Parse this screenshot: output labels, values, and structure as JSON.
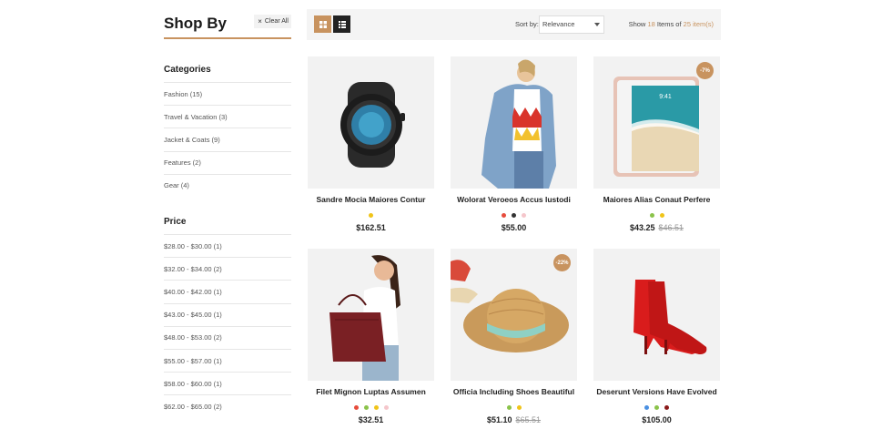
{
  "sidebar": {
    "title": "Shop By",
    "clear_all": "Clear All",
    "categories_title": "Categories",
    "categories": [
      {
        "label": "Fashion (15)"
      },
      {
        "label": "Travel & Vacation (3)"
      },
      {
        "label": "Jacket & Coats (9)"
      },
      {
        "label": "Features (2)"
      },
      {
        "label": "Gear (4)"
      }
    ],
    "price_title": "Price",
    "prices": [
      {
        "label": "$28.00 - $30.00 (1)"
      },
      {
        "label": "$32.00 - $34.00 (2)"
      },
      {
        "label": "$40.00 - $42.00 (1)"
      },
      {
        "label": "$43.00 - $45.00 (1)"
      },
      {
        "label": "$48.00 - $53.00 (2)"
      },
      {
        "label": "$55.00 - $57.00 (1)"
      },
      {
        "label": "$58.00 - $60.00 (1)"
      },
      {
        "label": "$62.00 - $65.00 (2)"
      }
    ]
  },
  "toolbar": {
    "grid_icon": "grid-view-icon",
    "list_icon": "list-view-icon",
    "sort_label": "Sort by:",
    "sort_value": "Relevance",
    "show_prefix": "Show",
    "show_count": "18",
    "show_middle": "Items of",
    "show_total": "25 item(s)"
  },
  "accent_color": "#c8935f",
  "products": [
    {
      "name": "Sandre Mocia Maiores Contur",
      "price": "$162.51",
      "old_price": "",
      "badge": "",
      "colors": [
        "#f0c419"
      ],
      "image": "smartwatch"
    },
    {
      "name": "Wolorat Veroeos Accus Iustodi",
      "price": "$55.00",
      "old_price": "",
      "badge": "",
      "colors": [
        "#e74c3c",
        "#333333",
        "#f5c6cb"
      ],
      "image": "denim-jacket-model"
    },
    {
      "name": "Maiores Alias Conaut Perfere",
      "price": "$43.25",
      "old_price": "$46.51",
      "badge": "-7%",
      "colors": [
        "#8bc34a",
        "#f0c419"
      ],
      "image": "tablet"
    },
    {
      "name": "Filet Mignon Luptas Assumen",
      "price": "$32.51",
      "old_price": "",
      "badge": "",
      "colors": [
        "#e74c3c",
        "#8bc34a",
        "#f0c419",
        "#f5c6cb"
      ],
      "image": "handbag-model"
    },
    {
      "name": "Officia Including Shoes Beautiful",
      "price": "$51.10",
      "old_price": "$65.51",
      "badge": "-22%",
      "colors": [
        "#8bc34a",
        "#f0c419"
      ],
      "image": "straw-hat"
    },
    {
      "name": "Deserunt Versions Have Evolved",
      "price": "$105.00",
      "old_price": "",
      "badge": "",
      "colors": [
        "#4a90e2",
        "#8bc34a",
        "#8b1a1a"
      ],
      "image": "red-boots"
    }
  ]
}
